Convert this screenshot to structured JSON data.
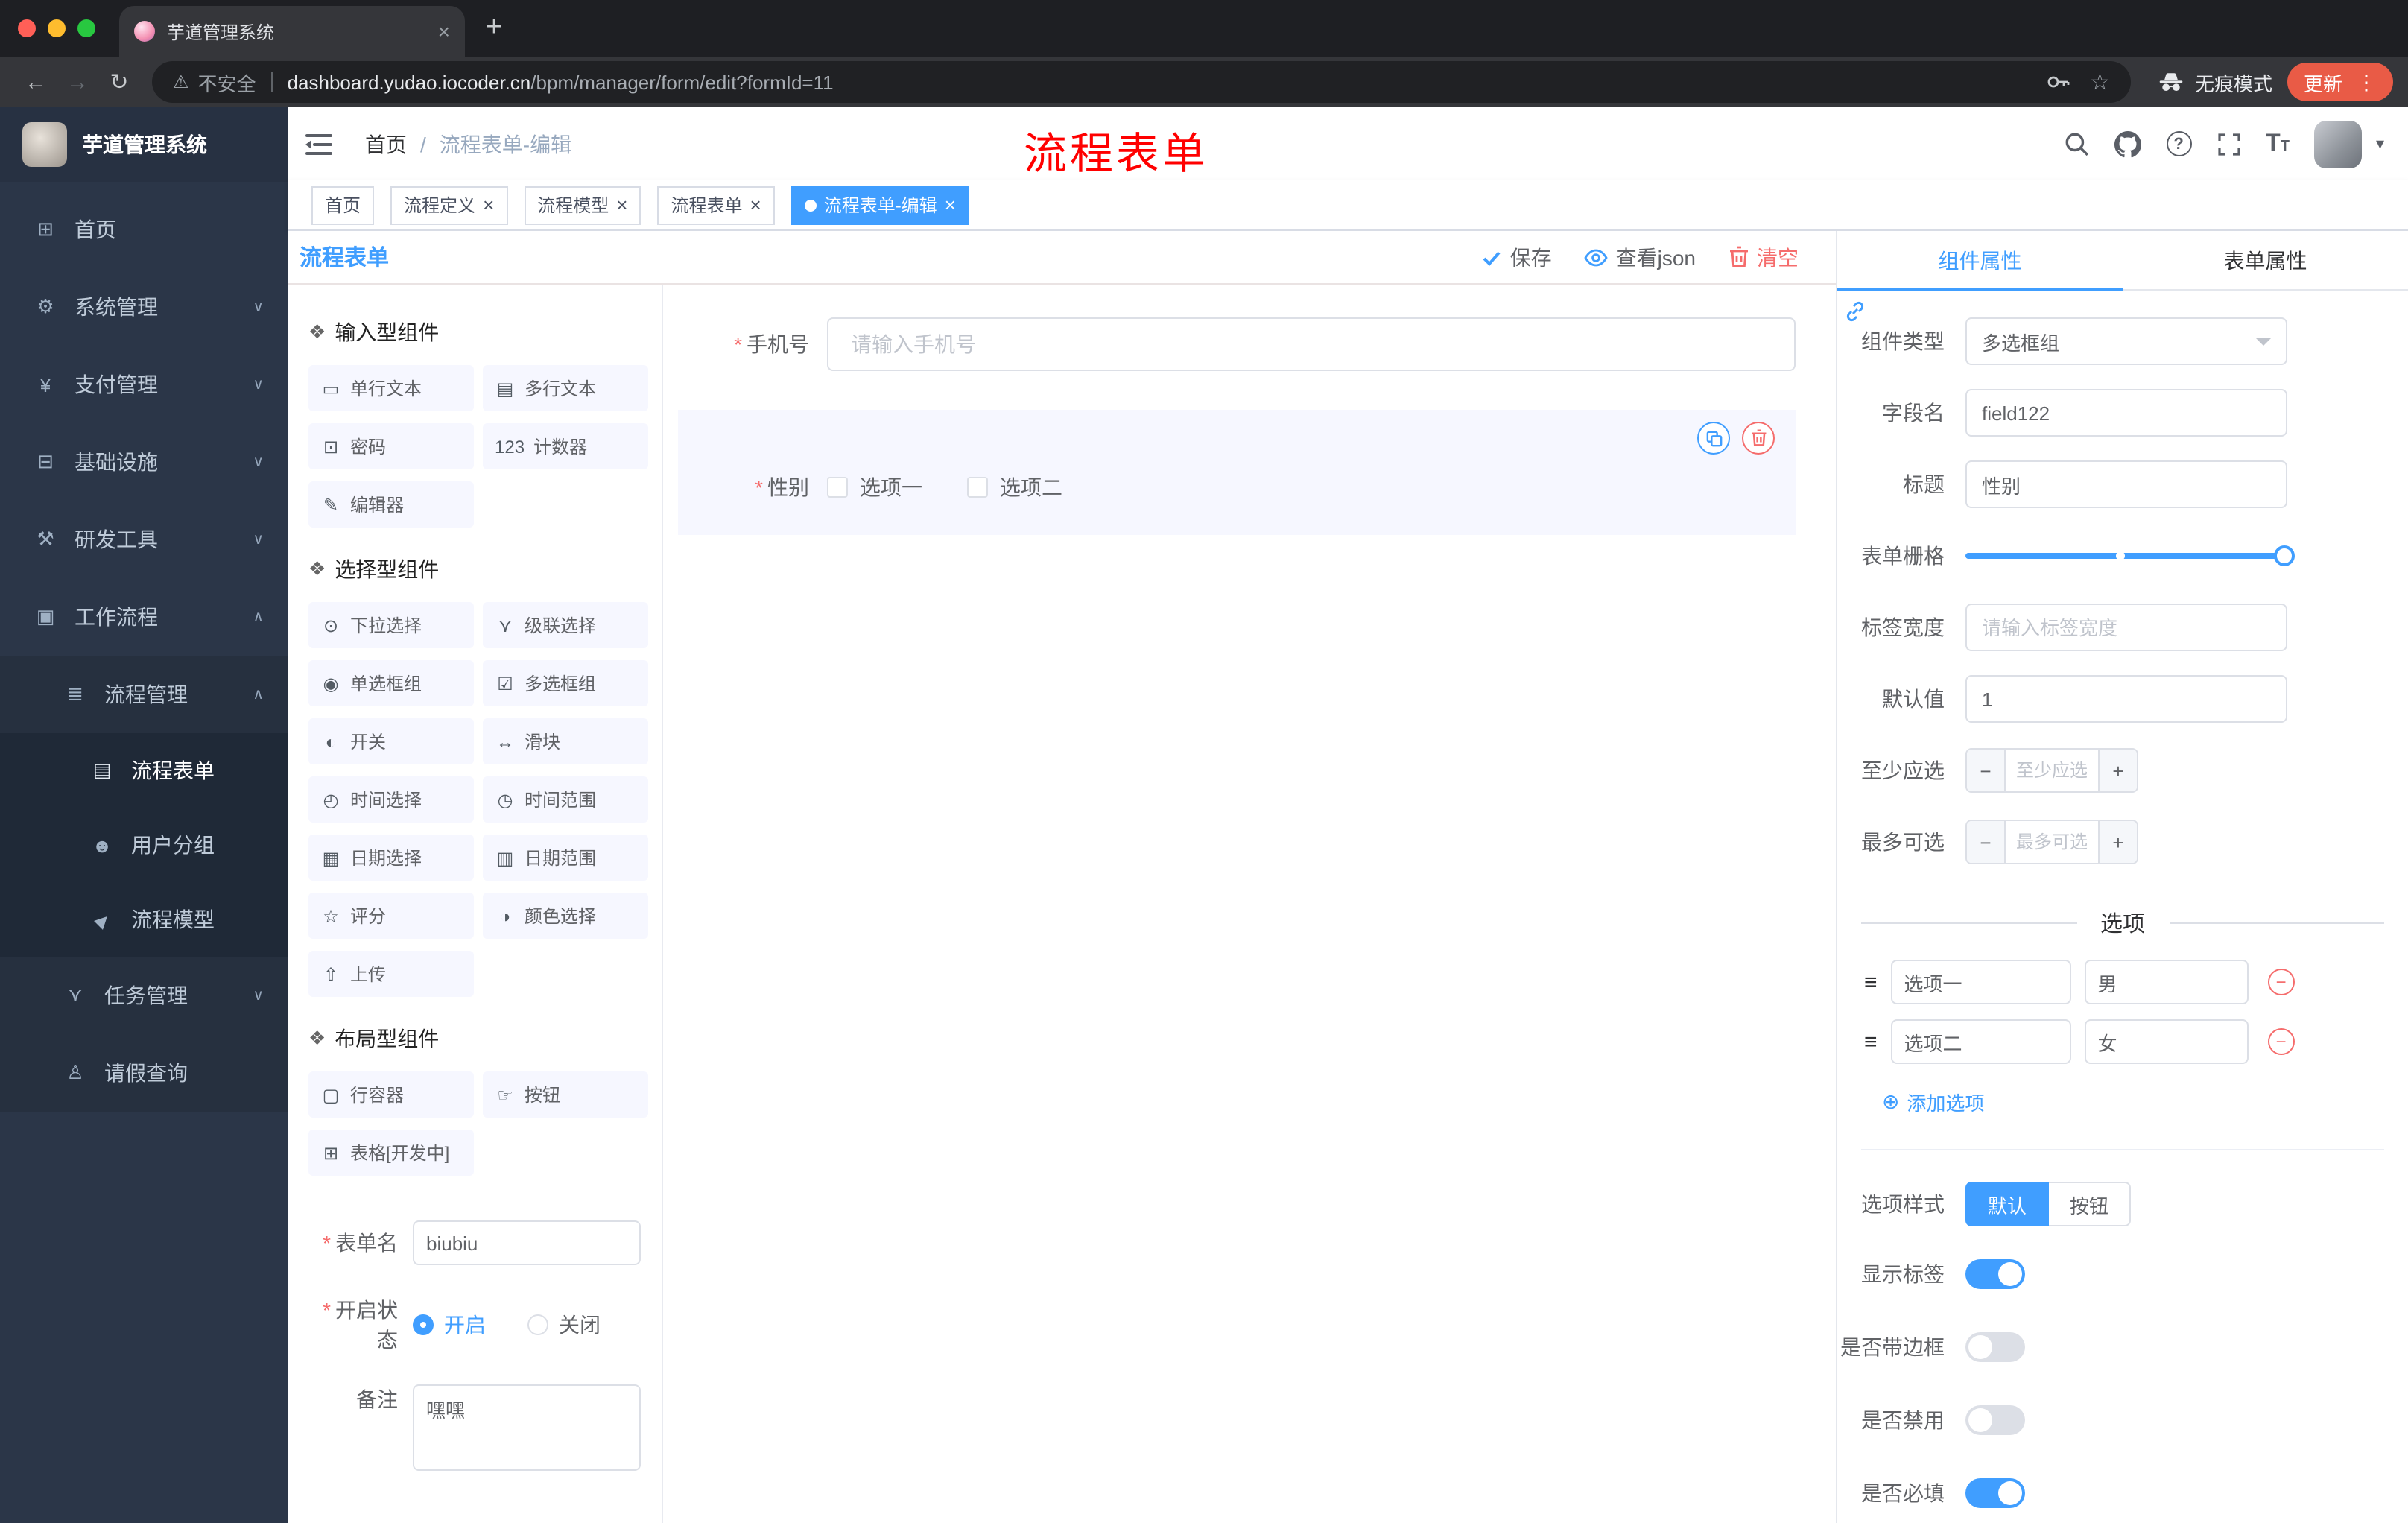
{
  "glyphs": {
    "close": "×",
    "new_tab": "+",
    "back": "←",
    "forward": "→",
    "reload": "↻",
    "warning": "⚠",
    "star": "☆",
    "kebab": "⋮",
    "breadcrumb_sep": "/",
    "required": "*",
    "minus": "−",
    "plus": "+",
    "add_circle": "⊕",
    "caret_down": "▾",
    "group_icon": "❖",
    "drag": "≡",
    "help": "?"
  },
  "browser": {
    "tab_title": "芋道管理系统",
    "security_label": "不安全",
    "url_host": "dashboard.yudao.iocoder.cn",
    "url_path": "/bpm/manager/form/edit?formId=11",
    "incognito_label": "无痕模式",
    "update_label": "更新"
  },
  "sidebar": {
    "logo_title": "芋道管理系统",
    "menu": [
      {
        "label": "首页",
        "icon": "⊞"
      },
      {
        "label": "系统管理",
        "icon": "⚙",
        "chevron": "∨"
      },
      {
        "label": "支付管理",
        "icon": "¥",
        "chevron": "∨"
      },
      {
        "label": "基础设施",
        "icon": "⊟",
        "chevron": "∨"
      },
      {
        "label": "研发工具",
        "icon": "⚒",
        "chevron": "∨"
      },
      {
        "label": "工作流程",
        "icon": "▣",
        "ch evron_note": "",
        "chevron": "∧"
      },
      {
        "label": "流程管理",
        "icon": "≣",
        "chevron": "∧",
        "lv2": true
      },
      {
        "label": "流程表单",
        "icon": "▤",
        "lv3": true,
        "active": true
      },
      {
        "label": "用户分组",
        "icon": "☻",
        "lv3": true
      },
      {
        "label": "流程模型",
        "icon": "▶",
        "lv3": true,
        "plane": true
      },
      {
        "label": "任务管理",
        "icon": "⋎",
        "chevron": "∨",
        "lv2": true
      },
      {
        "label": "请假查询",
        "icon": "♙",
        "lv2": true
      }
    ]
  },
  "header": {
    "breadcrumb_home": "首页",
    "breadcrumb_current": "流程表单-编辑",
    "annotation": "流程表单"
  },
  "tags": [
    {
      "label": "首页"
    },
    {
      "label": "流程定义",
      "closable": true
    },
    {
      "label": "流程模型",
      "closable": true
    },
    {
      "label": "流程表单",
      "closable": true
    },
    {
      "label": "流程表单-编辑",
      "closable": true,
      "active": true
    }
  ],
  "palette": {
    "title": "流程表单",
    "groups": [
      {
        "title": "输入型组件",
        "items": [
          {
            "label": "单行文本",
            "icon": "▭"
          },
          {
            "label": "多行文本",
            "icon": "▤"
          },
          {
            "label": "密码",
            "icon": "⊡"
          },
          {
            "label": "计数器",
            "icon": "123"
          },
          {
            "label": "编辑器",
            "icon": "✎"
          }
        ]
      },
      {
        "title": "选择型组件",
        "items": [
          {
            "label": "下拉选择",
            "icon": "⊙"
          },
          {
            "label": "级联选择",
            "icon": "⋎"
          },
          {
            "label": "单选框组",
            "icon": "◉"
          },
          {
            "label": "多选框组",
            "icon": "☑"
          },
          {
            "label": "开关",
            "icon": "◐"
          },
          {
            "label": "滑块",
            "icon": "↔"
          },
          {
            "label": "时间选择",
            "icon": "◴"
          },
          {
            "label": "时间范围",
            "icon": "◷"
          },
          {
            "label": "日期选择",
            "icon": "▦"
          },
          {
            "label": "日期范围",
            "icon": "▥"
          },
          {
            "label": "评分",
            "icon": "☆"
          },
          {
            "label": "颜色选择",
            "icon": "◑"
          },
          {
            "label": "上传",
            "icon": "⇧"
          }
        ]
      },
      {
        "title": "布局型组件",
        "items": [
          {
            "label": "行容器",
            "icon": "▢"
          },
          {
            "label": "按钮",
            "icon": "☞"
          },
          {
            "label": "表格[开发中]",
            "icon": "⊞"
          }
        ]
      }
    ],
    "meta": {
      "form_name_label": "表单名",
      "form_name_value": "biubiu",
      "status_label": "开启状态",
      "status_on": "开启",
      "status_off": "关闭",
      "remark_label": "备注",
      "remark_value": "嘿嘿"
    }
  },
  "canvas": {
    "save": "保存",
    "view_json": "查看json",
    "clear": "清空",
    "phone": {
      "label": "手机号",
      "placeholder": "请输入手机号"
    },
    "gender": {
      "label": "性别",
      "options": [
        "选项一",
        "选项二"
      ]
    }
  },
  "props": {
    "tab_component": "组件属性",
    "tab_form": "表单属性",
    "type_label": "组件类型",
    "type_value": "多选框组",
    "field_label": "字段名",
    "field_value": "field122",
    "title_label": "标题",
    "title_value": "性别",
    "grid_label": "表单栅格",
    "label_width_label": "标签宽度",
    "label_width_placeholder": "请输入标签宽度",
    "default_label": "默认值",
    "default_value": "1",
    "min_label": "至少应选",
    "min_placeholder": "至少应选",
    "max_label": "最多可选",
    "max_placeholder": "最多可选",
    "options_divider": "选项",
    "option_rows": [
      {
        "label": "选项一",
        "value": "男"
      },
      {
        "label": "选项二",
        "value": "女"
      }
    ],
    "add_option": "添加选项",
    "style_label": "选项样式",
    "style_default": "默认",
    "style_button": "按钮",
    "toggles": [
      {
        "label": "显示标签",
        "on": true
      },
      {
        "label": "是否带边框"
      },
      {
        "label": "是否禁用"
      },
      {
        "label": "是否必填",
        "on": true
      }
    ]
  }
}
